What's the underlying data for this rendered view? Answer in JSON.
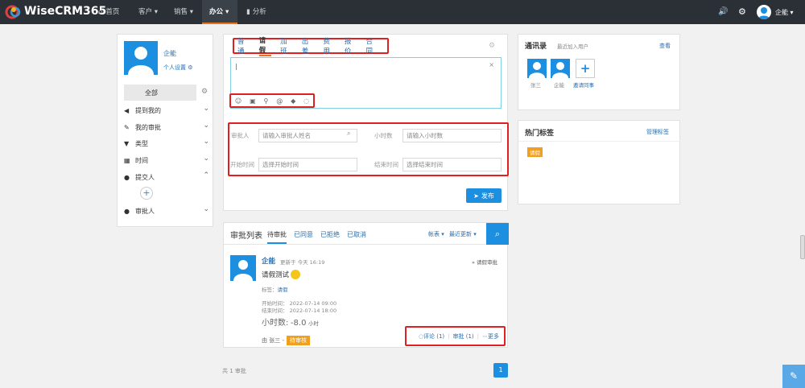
{
  "app": {
    "brand": "WiseCRM365"
  },
  "nav": {
    "home": "首页",
    "customer": "客户",
    "sales": "销售",
    "office": "办公",
    "analysis": "分析",
    "user": "企能"
  },
  "profile": {
    "name": "企能",
    "settings": "个人设置"
  },
  "sidebar": {
    "all": "全部",
    "mentioned": "提到我的",
    "my_approval": "我的审批",
    "type": "类型",
    "time": "时间",
    "submitter": "提交人",
    "approver": "审批人"
  },
  "composer": {
    "tabs": [
      "普通",
      "请假",
      "加班",
      "出差",
      "费用",
      "报价",
      "合同"
    ],
    "active_tab": "请假",
    "cursor": "|"
  },
  "form": {
    "approver_label": "审批人",
    "approver_placeholder": "请输入审批人姓名",
    "hours_label": "小时数",
    "hours_placeholder": "请输入小时数",
    "start_label": "开始时间",
    "start_placeholder": "选择开始时间",
    "end_label": "结束时间",
    "end_placeholder": "选择结束时间",
    "publish": "发布"
  },
  "list": {
    "title": "审批列表",
    "filters": [
      "待审批",
      "已同意",
      "已拒绝",
      "已取消"
    ],
    "view": "帐表",
    "sort": "最近更新"
  },
  "item": {
    "author": "企能",
    "updated": "更新于 今天 16:19",
    "type_link": "» 请假审批",
    "title": "请假测试",
    "tag_label": "标签：",
    "tag": "请假",
    "start": "开始时间： 2022-07-14 09:00",
    "end": "结束时间： 2022-07-14 18:00",
    "hours_label": "小时数:",
    "hours_value": "-8.0",
    "hours_unit": "小时",
    "from": "由 张三 -",
    "status": "待审核",
    "comment": "评论 (1)",
    "approve": "审批 (1)",
    "more": "更多"
  },
  "footer": {
    "total": "共 1 审批",
    "page": "1"
  },
  "contacts": {
    "title": "通讯录",
    "subtitle": "最近加入用户",
    "view": "查看",
    "users": [
      "张三",
      "企能"
    ],
    "invite": "邀请同事"
  },
  "tags": {
    "title": "热门标签",
    "manage": "管理标签",
    "items": [
      "请假"
    ]
  },
  "colors": {
    "accent": "#1c8fe0",
    "highlight": "#e02020",
    "status": "#f0a020"
  }
}
